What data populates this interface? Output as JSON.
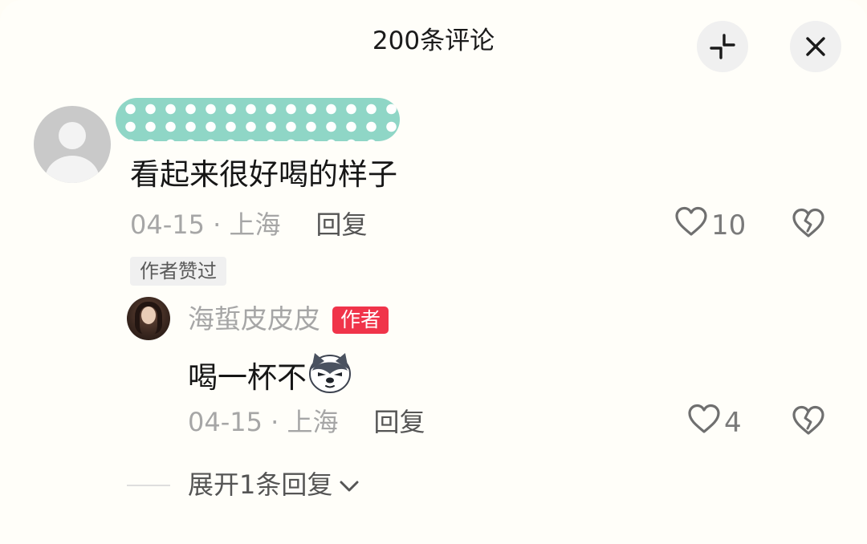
{
  "header": {
    "title": "200条评论",
    "collapse_icon": "collapse-icon",
    "close_icon": "close-icon"
  },
  "comment": {
    "avatar_icon": "default-avatar-icon",
    "text": "看起来很好喝的样子",
    "date": "04-15",
    "separator": " · ",
    "location": "上海",
    "reply_label": "回复",
    "like_count": "10",
    "author_liked_tag": "作者赞过"
  },
  "reply": {
    "author": "海蜇皮皮皮",
    "author_badge": "作者",
    "text": "喝一杯不",
    "emoji": "husky-dog-emoji",
    "date": "04-15",
    "separator": " · ",
    "location": "上海",
    "reply_label": "回复",
    "like_count": "4"
  },
  "expand": {
    "label": "展开1条回复"
  },
  "colors": {
    "badge": "#f0344a",
    "redacted": "#8fd6c6",
    "muted_text": "#a6a6a6"
  }
}
